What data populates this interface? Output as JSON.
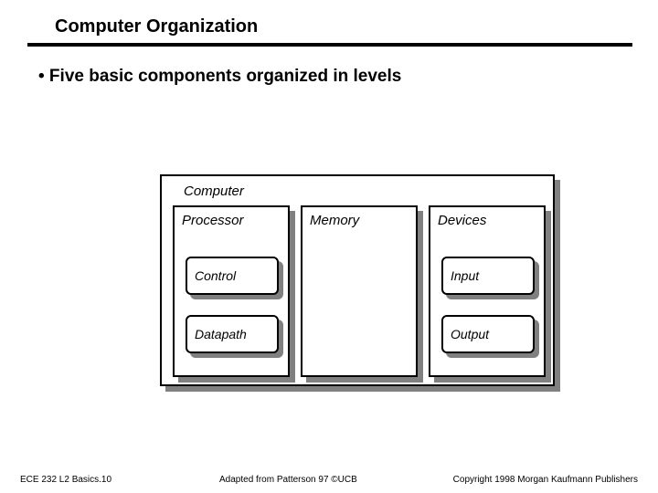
{
  "title": "Computer Organization",
  "bullet": "• Five basic components organized in levels",
  "diagram": {
    "outer_label": "Computer",
    "columns": {
      "processor": {
        "label": "Processor",
        "sub1": "Control",
        "sub2": "Datapath"
      },
      "memory": {
        "label": "Memory"
      },
      "devices": {
        "label": "Devices",
        "sub1": "Input",
        "sub2": "Output"
      }
    }
  },
  "footer": {
    "left": "ECE 232  L2 Basics.10",
    "mid": "Adapted from Patterson 97 ©UCB",
    "right": "Copyright 1998 Morgan Kaufmann Publishers"
  }
}
